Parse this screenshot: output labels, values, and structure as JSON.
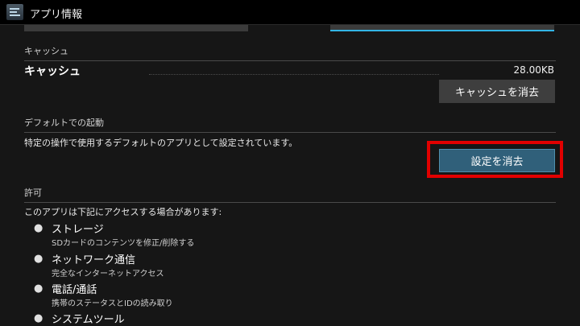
{
  "actionbar": {
    "title": "アプリ情報"
  },
  "cache": {
    "section_header": "キャッシュ",
    "row_label": "キャッシュ",
    "size": "28.00KB",
    "clear_button": "キャッシュを消去"
  },
  "default_launch": {
    "section_header": "デフォルトでの起動",
    "description": "特定の操作で使用するデフォルトのアプリとして設定されています。",
    "clear_button": "設定を消去"
  },
  "permissions": {
    "section_header": "許可",
    "intro": "このアプリは下記にアクセスする場合があります:",
    "items": [
      {
        "title": "ストレージ",
        "desc": "SDカードのコンテンツを修正/削除する"
      },
      {
        "title": "ネットワーク通信",
        "desc": "完全なインターネットアクセス"
      },
      {
        "title": "電話/通話",
        "desc": "携帯のステータスとIDの読み取り"
      },
      {
        "title": "システムツール",
        "desc": ""
      }
    ]
  },
  "colors": {
    "highlight": "#e10000",
    "accent": "#33b5e5"
  },
  "icons": {
    "app": "app-settings-icon",
    "bullet": "bullet-icon"
  }
}
